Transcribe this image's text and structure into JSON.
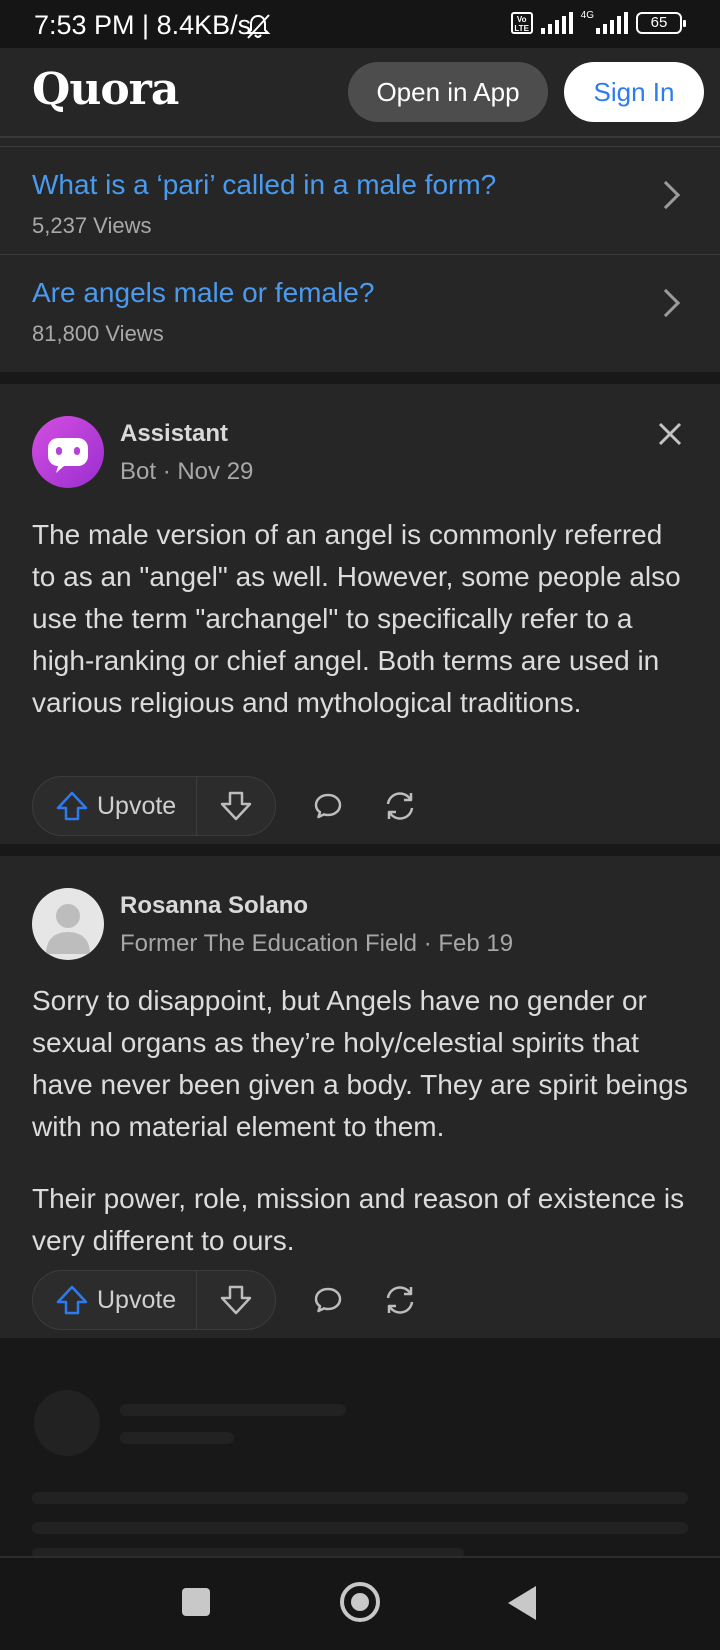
{
  "status_bar": {
    "time": "7:53 PM | 8.4KB/s",
    "volte": "Vo LTE",
    "network": "4G",
    "battery": "65"
  },
  "header": {
    "logo": "Quora",
    "open_in_app": "Open in App",
    "sign_in": "Sign In"
  },
  "related_questions": [
    {
      "question": "What is a ‘pari’ called in a male form?",
      "views": "5,237 Views"
    },
    {
      "question": "Are angels male or female?",
      "views": "81,800 Views"
    }
  ],
  "answers": [
    {
      "author": "Assistant",
      "meta": "Bot · Nov 29",
      "paragraphs": [
        "The male version of an angel is commonly referred to as an \"angel\" as well. However, some people also use the term \"archangel\" to specifically refer to a high-ranking or chief angel. Both terms are used in various religious and mythological traditions."
      ],
      "upvote_label": "Upvote"
    },
    {
      "author": "Rosanna Solano",
      "meta": "Former The Education Field · Feb 19",
      "paragraphs": [
        "Sorry to disappoint, but Angels have no gender or sexual organs as they’re holy/celestial spirits that have never been given a body. They are spirit beings with no material element to them.",
        "Their power, role, mission and reason of existence is very different to ours."
      ],
      "upvote_label": "Upvote"
    }
  ],
  "colors": {
    "link": "#4a9bef",
    "upvote_icon": "#2e7bf0",
    "bot_avatar": "#b93fdc"
  }
}
